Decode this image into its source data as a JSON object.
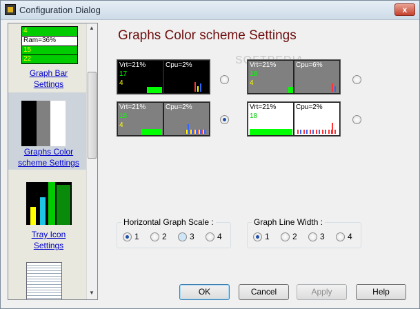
{
  "window": {
    "title": "Configuration Dialog",
    "close_label": "x"
  },
  "sidebar": {
    "items": [
      {
        "label_line1": "Graph Bar",
        "label_line2": "Settings",
        "thumb_text1": "4",
        "thumb_text2": "Ram=36%",
        "thumb_text3": "15",
        "thumb_text4": "22"
      },
      {
        "label_line1": "Graphs Color",
        "label_line2": "scheme Settings"
      },
      {
        "label_line1": "Tray Icon",
        "label_line2": "Settings"
      }
    ]
  },
  "heading": "Graphs Color scheme Settings",
  "watermark": "SOFTPEDIA",
  "schemes": [
    {
      "left": {
        "line1": "Vrt=21%",
        "line2": "17",
        "line3": "4"
      },
      "right": {
        "line1": "Cpu=2%"
      },
      "selected": false
    },
    {
      "left": {
        "line1": "Vrt=21%",
        "line2": "18",
        "line3": "4"
      },
      "right": {
        "line1": "Cpu=6%"
      },
      "selected": false
    },
    {
      "left": {
        "line1": "Vrt=21%",
        "line2": "18",
        "line3": "4"
      },
      "right": {
        "line1": "Cpu=2%"
      },
      "selected": true
    },
    {
      "left": {
        "line1": "Vrt=21%",
        "line2": "18",
        "line3": ""
      },
      "right": {
        "line1": "Cpu=2%"
      },
      "selected": false
    }
  ],
  "horizontal_scale": {
    "title": "Horizontal Graph Scale :",
    "options": [
      "1",
      "2",
      "3",
      "4"
    ],
    "selected": "1"
  },
  "line_width": {
    "title": "Graph Line Width :",
    "options": [
      "1",
      "2",
      "3",
      "4"
    ],
    "selected": "1"
  },
  "buttons": {
    "ok": "OK",
    "cancel": "Cancel",
    "apply": "Apply",
    "help": "Help"
  }
}
